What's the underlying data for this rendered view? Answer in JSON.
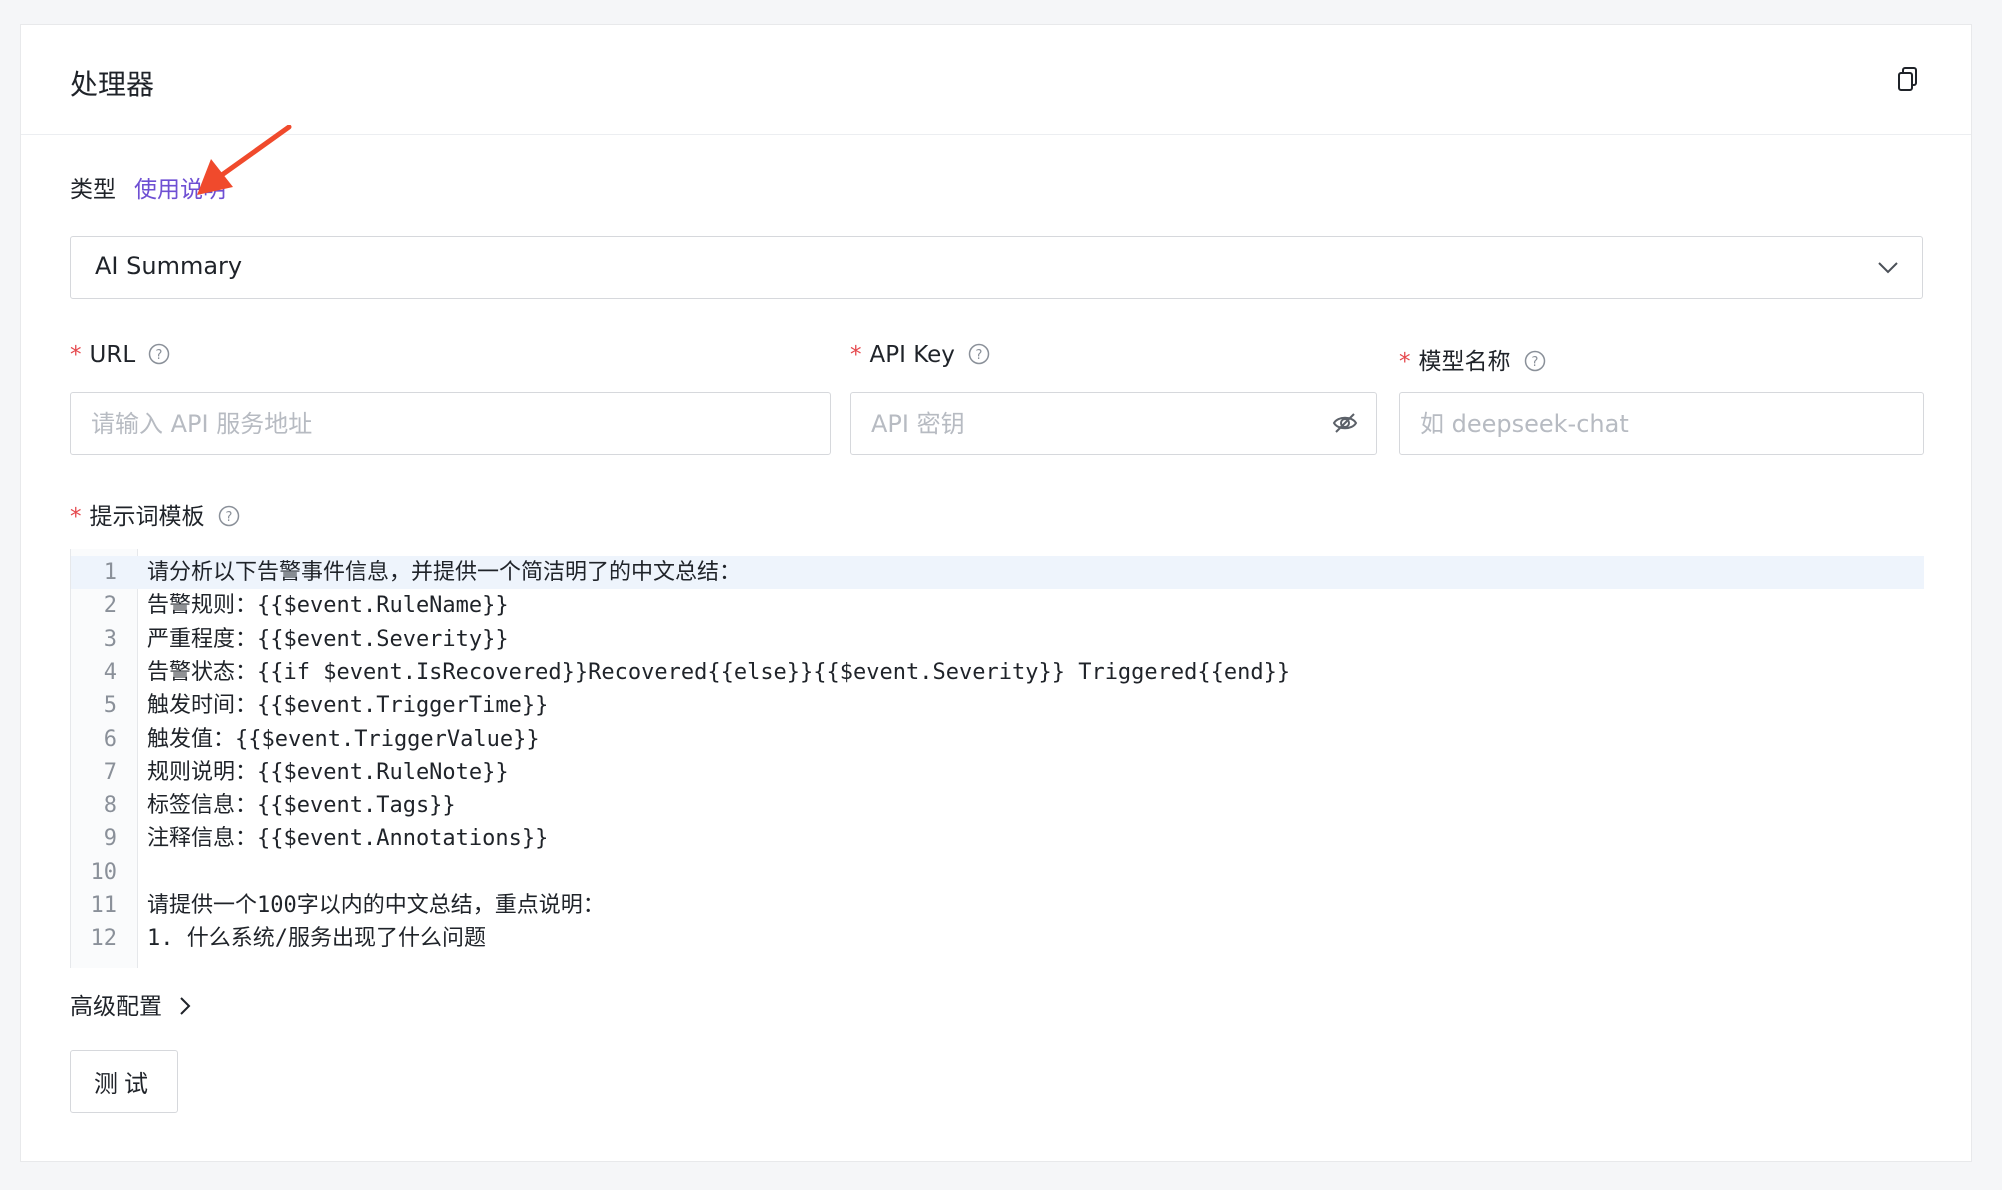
{
  "panel": {
    "title": "处理器"
  },
  "type_field": {
    "label": "类型",
    "help_link": "使用说明",
    "selected": "AI Summary"
  },
  "fields": {
    "url": {
      "label": "URL",
      "placeholder": "请输入 API 服务地址",
      "value": ""
    },
    "api_key": {
      "label": "API Key",
      "placeholder": "API 密钥",
      "value": ""
    },
    "model": {
      "label": "模型名称",
      "placeholder": "如 deepseek-chat",
      "value": ""
    }
  },
  "prompt": {
    "label": "提示词模板",
    "lines": [
      {
        "n": "1",
        "text": "请分析以下告警事件信息，并提供一个简洁明了的中文总结："
      },
      {
        "n": "2",
        "text": "告警规则：{{$event.RuleName}}"
      },
      {
        "n": "3",
        "text": "严重程度：{{$event.Severity}}"
      },
      {
        "n": "4",
        "text": "告警状态：{{if $event.IsRecovered}}Recovered{{else}}{{$event.Severity}} Triggered{{end}}"
      },
      {
        "n": "5",
        "text": "触发时间：{{$event.TriggerTime}}"
      },
      {
        "n": "6",
        "text": "触发值：{{$event.TriggerValue}}"
      },
      {
        "n": "7",
        "text": "规则说明：{{$event.RuleNote}}"
      },
      {
        "n": "8",
        "text": "标签信息：{{$event.Tags}}"
      },
      {
        "n": "9",
        "text": "注释信息：{{$event.Annotations}}"
      },
      {
        "n": "10",
        "text": ""
      },
      {
        "n": "11",
        "text": "请提供一个100字以内的中文总结，重点说明："
      },
      {
        "n": "12",
        "text": "1. 什么系统/服务出现了什么问题"
      }
    ]
  },
  "advanced": {
    "label": "高级配置"
  },
  "test_button": {
    "label": "测试"
  },
  "colors": {
    "accent_link": "#6e4fd3",
    "required": "#e5484d",
    "annotation_arrow": "#f04a2c"
  }
}
